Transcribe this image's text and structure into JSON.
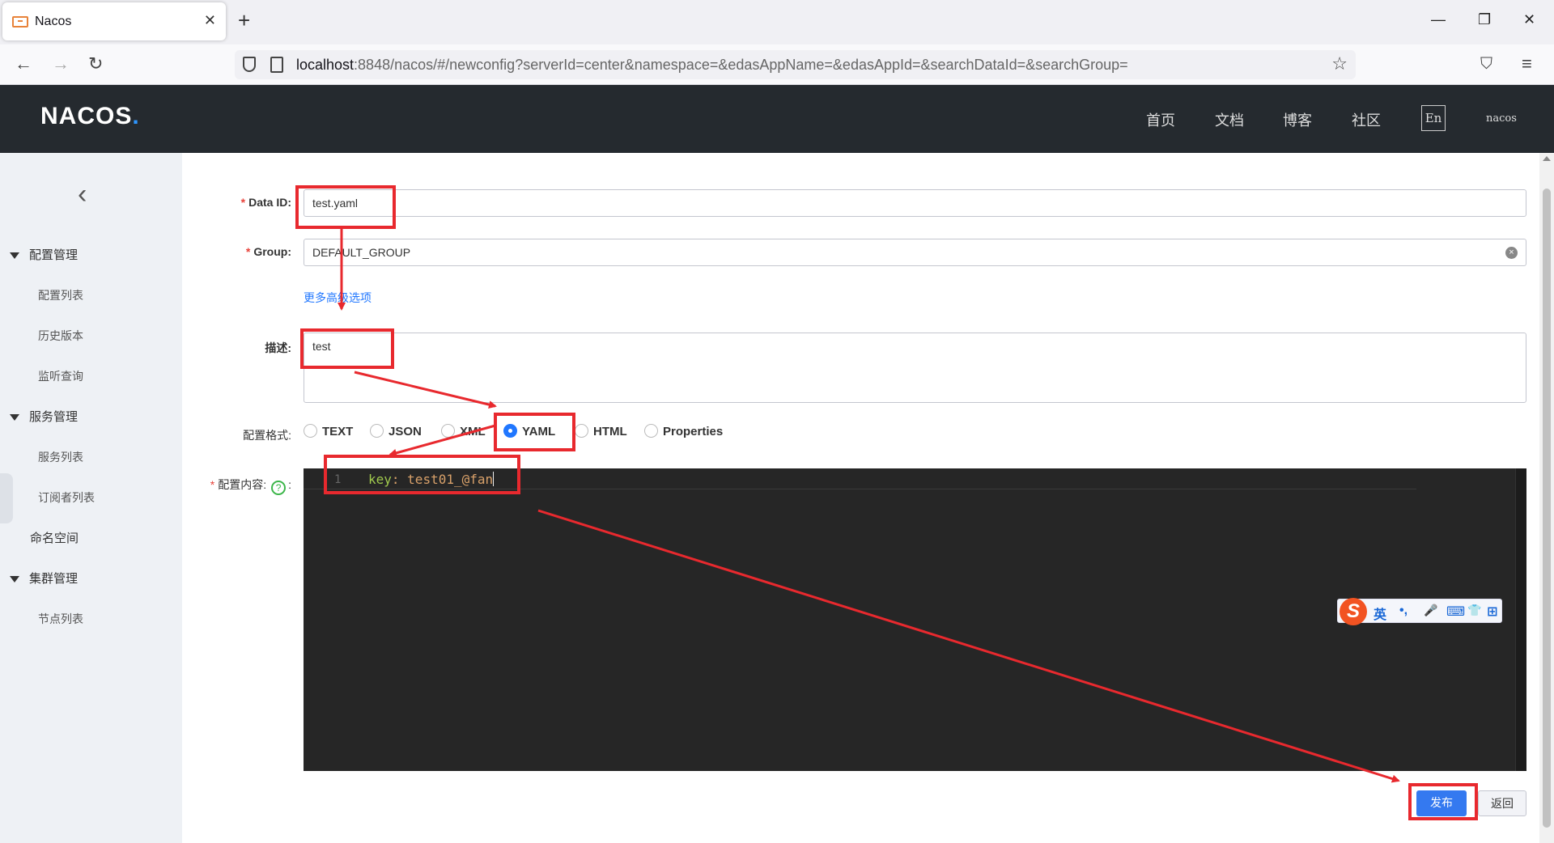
{
  "browser": {
    "tab_title": "Nacos",
    "tab_close": "✕",
    "new_tab": "+",
    "win_min": "—",
    "win_restore": "❐",
    "win_close": "✕",
    "back": "←",
    "forward": "→",
    "reload": "↻",
    "url_host": "localhost",
    "url_rest": ":8848/nacos/#/newconfig?serverId=center&namespace=&edasAppName=&edasAppId=&searchDataId=&searchGroup=",
    "bookmark_icon": "☆",
    "pocket_icon": "⛉",
    "menu_icon": "≡"
  },
  "header": {
    "logo_text": "NACOS",
    "logo_dot": ".",
    "nav": [
      "首页",
      "文档",
      "博客",
      "社区"
    ],
    "lang": "En",
    "user": "nacos"
  },
  "sidebar": {
    "back": "‹",
    "groups": [
      {
        "label": "配置管理",
        "items": [
          "配置列表",
          "历史版本",
          "监听查询"
        ]
      },
      {
        "label": "服务管理",
        "items": [
          "服务列表",
          "订阅者列表"
        ]
      },
      {
        "label": "命名空间"
      },
      {
        "label": "集群管理",
        "items": [
          "节点列表"
        ]
      }
    ]
  },
  "form": {
    "data_id_label": "Data ID:",
    "data_id_value": "test.yaml",
    "group_label": "Group:",
    "group_value": "DEFAULT_GROUP",
    "group_clear": "×",
    "advanced_link": "更多高级选项",
    "desc_label": "描述:",
    "desc_value": "test",
    "format_label": "配置格式:",
    "formats": [
      "TEXT",
      "JSON",
      "XML",
      "YAML",
      "HTML",
      "Properties"
    ],
    "selected_format": "YAML",
    "content_label": "配置内容:",
    "help": "?",
    "content_colon": ":",
    "required_mark": "*"
  },
  "editor": {
    "line_number": "1",
    "key": "key",
    "colon": ": ",
    "value": "test01_@fan"
  },
  "ime": {
    "logo": "S",
    "items": [
      "英",
      "•,",
      "🎤",
      "⌨",
      "👕",
      "⊞"
    ]
  },
  "actions": {
    "publish": "发布",
    "back": "返回"
  },
  "colors": {
    "header_bg": "#252a2f",
    "primary": "#3479f0",
    "annotation": "#e8292e",
    "editor_bg": "#262626"
  }
}
